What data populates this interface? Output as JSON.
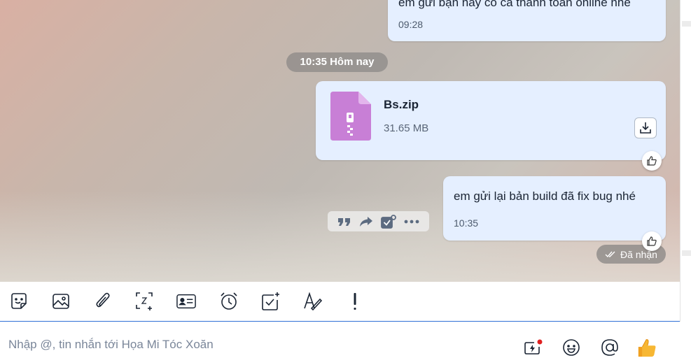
{
  "messages": [
    {
      "type": "text",
      "text": "em gửi bạn này có cả thanh toán online nhé",
      "time": "09:28"
    },
    {
      "type": "file",
      "file_name": "Bs.zip",
      "file_size": "31.65 MB"
    },
    {
      "type": "text",
      "text": "em gửi lại bản build đã fix bug nhé",
      "time": "10:35"
    }
  ],
  "date_separator": "10:35 Hôm nay",
  "status": "Đã nhận",
  "hover_actions": [
    "quote-icon",
    "forward-icon",
    "add-task-icon",
    "more-icon"
  ],
  "toolbar_icons": [
    "sticker-icon",
    "image-icon",
    "attachment-icon",
    "screenshot-icon",
    "contact-card-icon",
    "reminder-icon",
    "todo-icon",
    "format-text-icon",
    "urgent-icon"
  ],
  "input": {
    "placeholder": "Nhập @, tin nhắn tới Họa Mi Tóc Xoăn",
    "value": ""
  },
  "input_icons": [
    "quick-message-icon",
    "emoji-icon",
    "mention-icon",
    "like-icon"
  ],
  "colors": {
    "bubble": "#e5efff",
    "accent": "#2f6fd6",
    "zip": "#c87fd6"
  }
}
